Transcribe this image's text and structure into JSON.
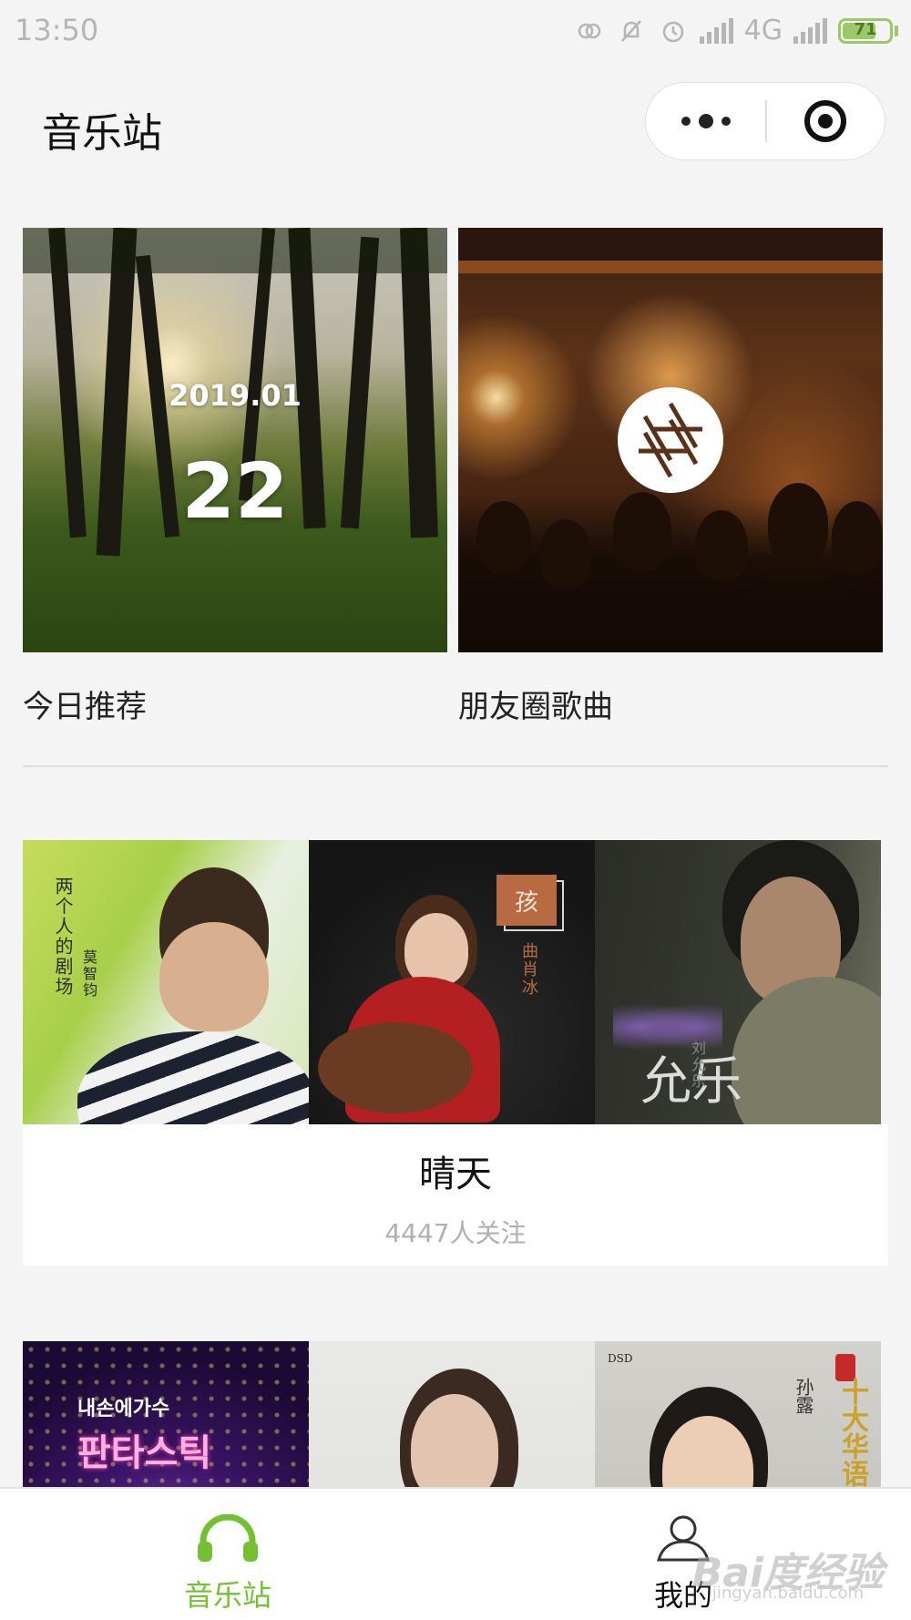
{
  "status_bar": {
    "time": "13:50",
    "network": "4G",
    "battery": "71",
    "battery_level": 0.71,
    "icons": [
      "wechat-mini-icon",
      "mute-bell-icon",
      "alarm-icon",
      "signal-icon",
      "signal-icon"
    ]
  },
  "header": {
    "title": "音乐站",
    "more_icon": "ellipsis-icon",
    "close_icon": "target-icon"
  },
  "featured": [
    {
      "label": "今日推荐",
      "date": "2019.01",
      "day": "22"
    },
    {
      "label": "朋友圈歌曲",
      "icon": "aperture-icon"
    }
  ],
  "playlists": [
    {
      "name": "晴天",
      "followers": "4447人关注",
      "covers": [
        {
          "vertical_text": "两个人的剧场",
          "artist": "莫智钧"
        },
        {
          "badge": "孩",
          "artist": "曲肖冰"
        },
        {
          "title": "允乐",
          "artist": "刘允乐"
        }
      ]
    },
    {
      "covers": [
        {
          "top_text": "내손에가수",
          "title": "판타스틱"
        },
        {},
        {
          "tag": "DSD",
          "artist": "孙露",
          "title": "十大华语"
        }
      ]
    }
  ],
  "tabbar": {
    "items": [
      {
        "label": "音乐站",
        "icon": "headphones-icon",
        "active": true
      },
      {
        "label": "我的",
        "icon": "person-icon",
        "active": false
      }
    ]
  },
  "watermark": {
    "brand": "Bai度经验",
    "url": "jingyan.baidu.com"
  },
  "colors": {
    "accent": "#73c133",
    "background": "#f4f4f4",
    "muted_text": "#b0b0b0"
  }
}
